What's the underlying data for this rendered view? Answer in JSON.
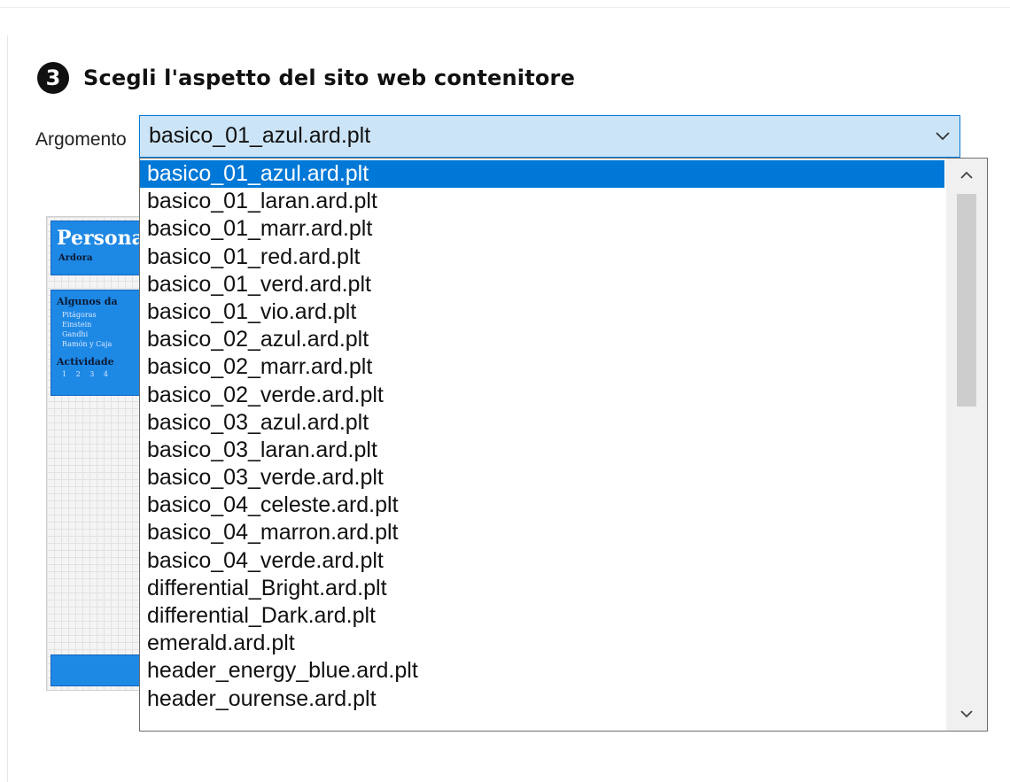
{
  "section": {
    "step_number": "3",
    "title": "Scegli l'aspetto del sito web contenitore"
  },
  "field": {
    "label": "Argomento"
  },
  "combo": {
    "selected_value": "basico_01_azul.ard.plt"
  },
  "preview": {
    "title": "Persona",
    "subtitle": "Ardora",
    "panel_title": "Algunos da",
    "list": [
      "Pitágoras",
      "Einstein",
      "Gandhi",
      "Ramón y Caja"
    ],
    "panel_sub": "Actividade",
    "numbers": "1 2 3 4"
  },
  "dropdown": {
    "options": [
      "basico_01_azul.ard.plt",
      "basico_01_laran.ard.plt",
      "basico_01_marr.ard.plt",
      "basico_01_red.ard.plt",
      "basico_01_verd.ard.plt",
      "basico_01_vio.ard.plt",
      "basico_02_azul.ard.plt",
      "basico_02_marr.ard.plt",
      "basico_02_verde.ard.plt",
      "basico_03_azul.ard.plt",
      "basico_03_laran.ard.plt",
      "basico_03_verde.ard.plt",
      "basico_04_celeste.ard.plt",
      "basico_04_marron.ard.plt",
      "basico_04_verde.ard.plt",
      "differential_Bright.ard.plt",
      "differential_Dark.ard.plt",
      "emerald.ard.plt",
      "header_energy_blue.ard.plt",
      "header_ourense.ard.plt"
    ],
    "selected_index": 0
  },
  "icons": {
    "combo_arrow": "chevron-down-icon",
    "scroll_up": "chevron-up-icon",
    "scroll_down": "chevron-down-icon"
  },
  "colors": {
    "selection": "#0078d7",
    "combo_background": "#cce4f7",
    "preview_blue": "#1e88e5"
  }
}
